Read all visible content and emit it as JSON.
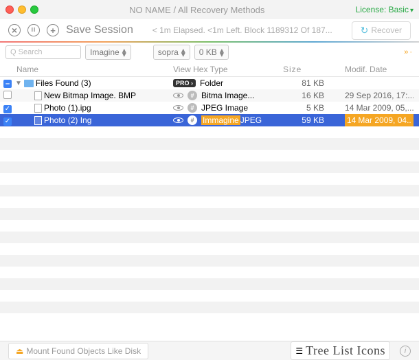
{
  "titlebar": {
    "title": "NO NAME / All Recovery Methods",
    "license": "License: Basic"
  },
  "toolbar": {
    "save": "Save Session",
    "status": "< 1m Elapsed. <1m Left. Block 1189312 Of 187...",
    "recover": "Recover"
  },
  "filters": {
    "search_ph": "Q  Search",
    "dd1": "Imagine",
    "dd2": "sopra",
    "dd3": "0 KB",
    "right": "»·"
  },
  "headers": {
    "name": "Name",
    "view": "View Hex Type",
    "size": "Size",
    "date": "Modif. Date"
  },
  "rows": [
    {
      "check": "minus",
      "indent": 0,
      "pre": "▼",
      "icon": "folder",
      "name": "Files Found (3)",
      "badge": "PRO ›",
      "type": "Folder",
      "size": "81 KB",
      "date": ""
    },
    {
      "check": "none",
      "indent": 2,
      "icon": "file",
      "name": "New Bitmap Image. BMP",
      "eye": true,
      "hex": true,
      "type": "Bitma Image...",
      "size": "16 KB",
      "date": "29 Sep 2016, 17:..."
    },
    {
      "check": "on",
      "indent": 2,
      "icon": "file",
      "name": "Photo (1).ipg",
      "eye": true,
      "hex": true,
      "type": "JPEG Image",
      "size": "5 KB",
      "date": "14 Mar 2009, 05,..."
    },
    {
      "check": "on",
      "indent": 2,
      "icon": "file",
      "name": "Photo (2) Ing",
      "eye": true,
      "hex": true,
      "type_hl": "Immagine",
      "type_suf": "JPEG",
      "size": "59 KB",
      "date_pre": "14",
      "date_hl": "Mar 2009, 04...",
      "selected": true
    }
  ],
  "footer": {
    "mount": "Mount Found Objects Like Disk",
    "view": "Tree List Icons"
  }
}
